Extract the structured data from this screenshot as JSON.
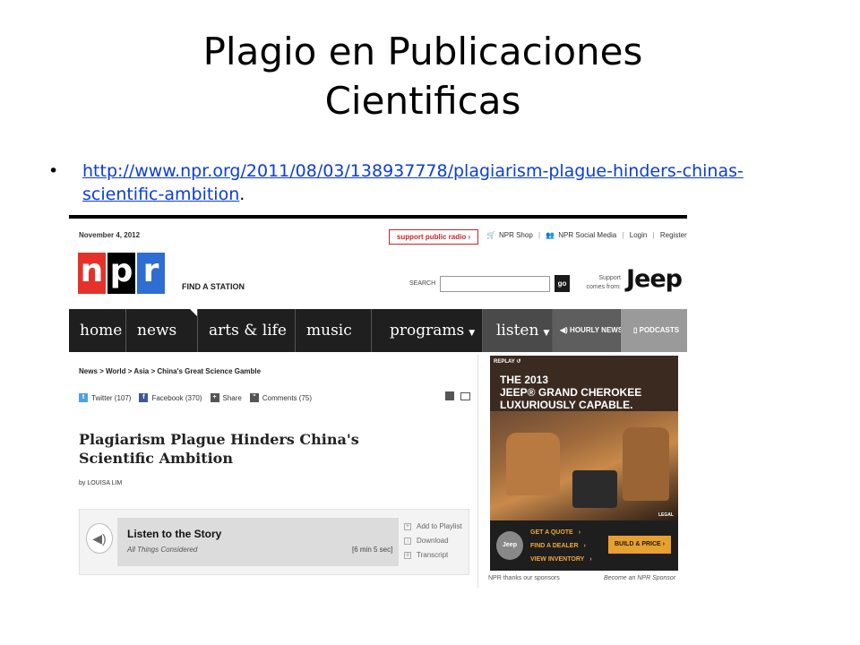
{
  "slide": {
    "title_line1": "Plagio en Publicaciones",
    "title_line2": "Cientificas",
    "bullet_link_line1": "http://www.npr.org/2011/08/03/138937778/plagiarism-plague-hinders-chinas-",
    "bullet_link_line2": "scientific-ambition",
    "bullet_suffix": "."
  },
  "npr": {
    "date": "November 4, 2012",
    "support_btn": "support public radio ›",
    "top_links": [
      "NPR Shop",
      "NPR Social Media",
      "Login",
      "Register"
    ],
    "logo_letters": [
      "n",
      "p",
      "r"
    ],
    "logo_colors": [
      "#e4322b",
      "#000000",
      "#2e6dd1"
    ],
    "find_station": "FIND A STATION",
    "search_label": "SEARCH",
    "search_go": "go",
    "support_from": "Support comes from:",
    "sponsor_logo": "Jeep",
    "nav": [
      "home",
      "news",
      "arts & life",
      "music",
      "programs",
      "listen",
      "HOURLY NEWS",
      "PODCASTS"
    ],
    "breadcrumb": "News > World > Asia > China's Great Science Gamble",
    "social": {
      "twitter": "Twitter (107)",
      "facebook": "Facebook (370)",
      "share": "Share",
      "comments": "Comments (75)"
    },
    "headline": "Plagiarism Plague Hinders China's Scientific Ambition",
    "byline": "by LOUISA LIM",
    "player": {
      "title": "Listen to the Story",
      "program": "All Things Considered",
      "duration": "[6 min 5 sec]",
      "actions": [
        "Add to Playlist",
        "Download",
        "Transcript"
      ]
    },
    "ad": {
      "replay": "REPLAY ↺",
      "line1": "THE 2013",
      "line2": "JEEP® GRAND CHEROKEE",
      "line3": "LUXURIOUSLY CAPABLE.",
      "legal": "LEGAL",
      "badge": "Jeep",
      "links": [
        "GET A QUOTE",
        "FIND A DEALER",
        "VIEW INVENTORY"
      ],
      "build": "BUILD & PRICE ›"
    },
    "thanks": "NPR thanks our sponsors",
    "become_sponsor": "Become an NPR Sponsor"
  }
}
